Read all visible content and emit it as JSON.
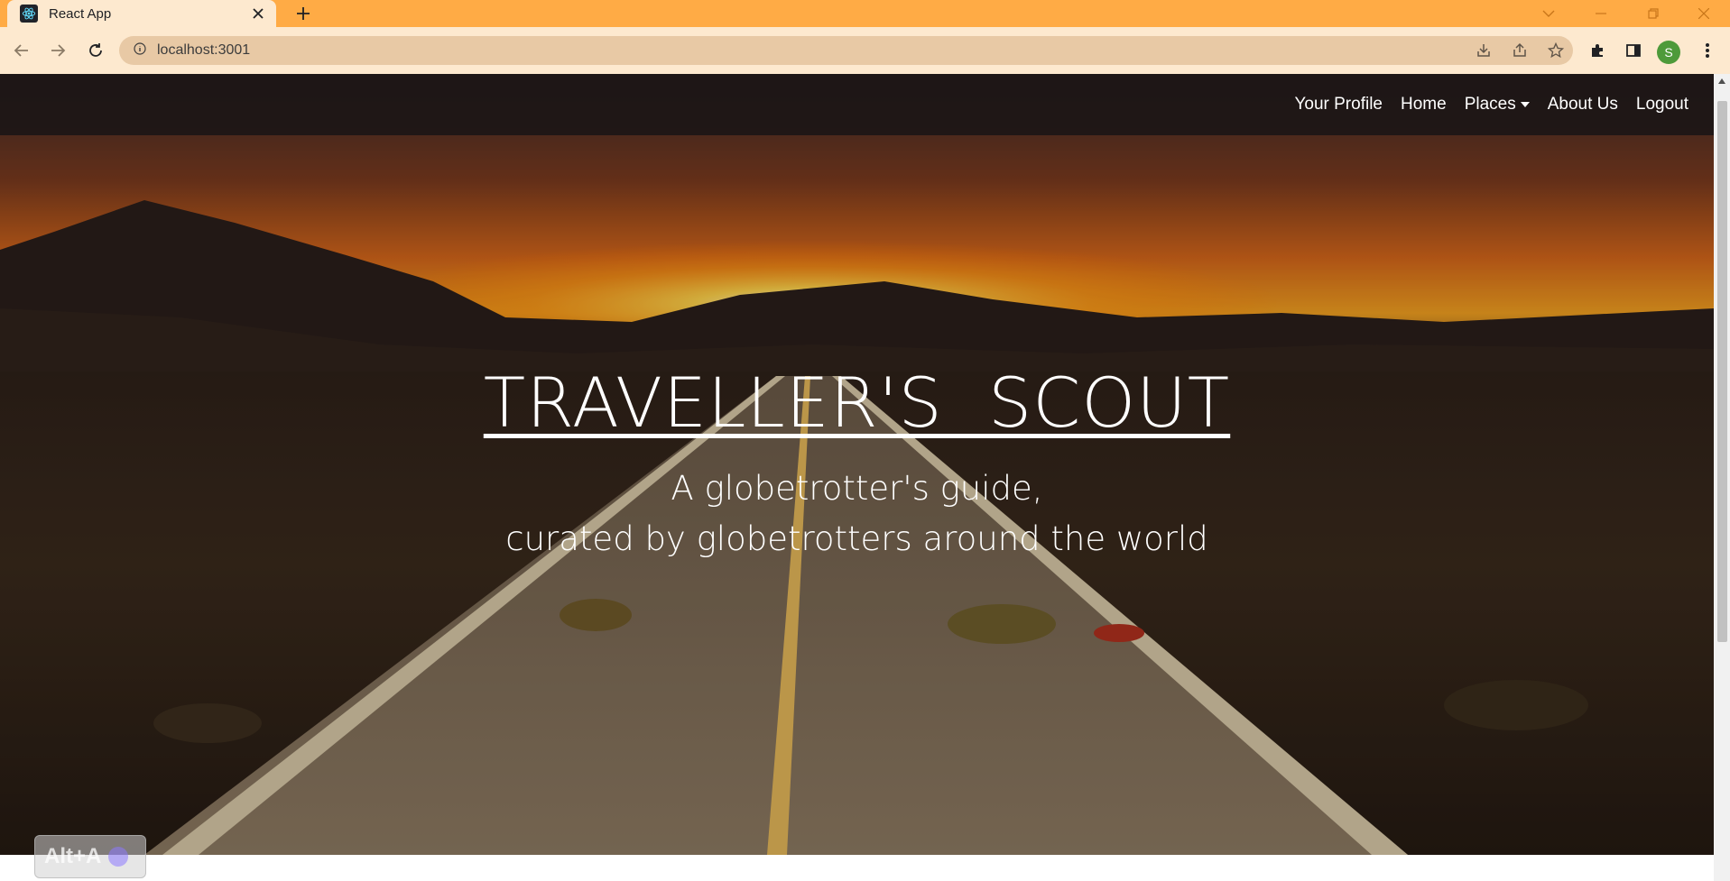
{
  "browser": {
    "tab_title": "React App",
    "url": "localhost:3001",
    "profile_initial": "S",
    "theme_color": "#ffab45"
  },
  "navbar": {
    "links": [
      {
        "label": "Your Profile"
      },
      {
        "label": "Home"
      },
      {
        "label": "Places",
        "dropdown": true
      },
      {
        "label": "About Us"
      },
      {
        "label": "Logout"
      }
    ]
  },
  "hero": {
    "title": "TRAVELLER'S  SCOUT",
    "subtitle_line1": "A globetrotter's guide,",
    "subtitle_line2": "curated by globetrotters around the world"
  },
  "overlay": {
    "shortcut_badge": "Alt+A"
  },
  "icons": [
    "react-icon",
    "close-icon",
    "plus-icon",
    "back-icon",
    "forward-icon",
    "reload-icon",
    "info-icon",
    "install-icon",
    "share-icon",
    "star-icon",
    "puzzle-icon",
    "sidepanel-icon",
    "kebab-menu-icon"
  ]
}
